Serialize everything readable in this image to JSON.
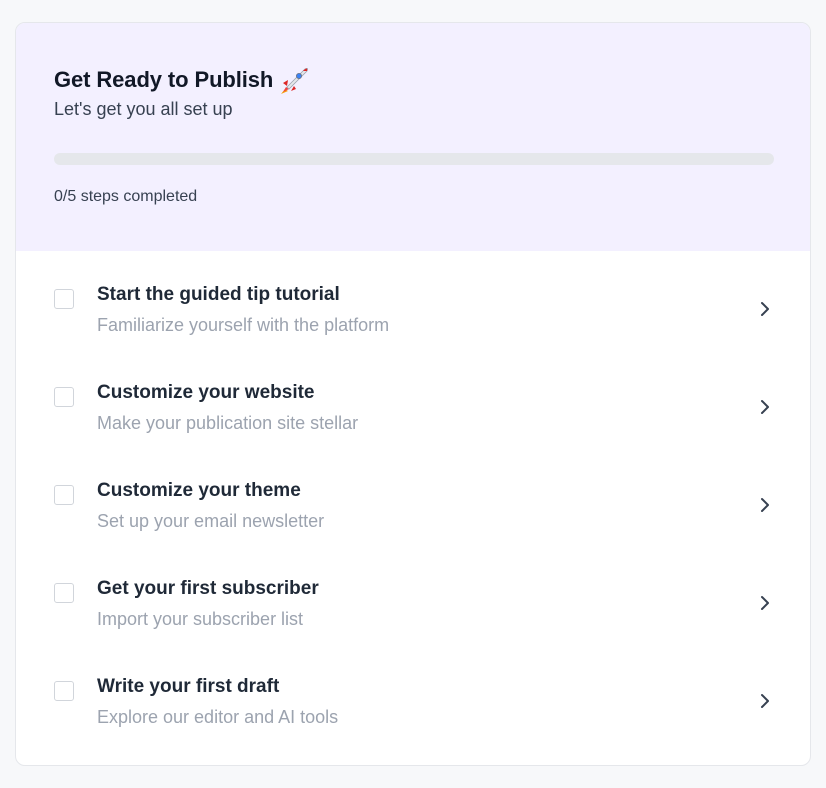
{
  "header": {
    "title": "Get Ready to Publish",
    "title_icon": "rocket-emoji",
    "subtitle": "Let's get you all set up",
    "progress": {
      "completed": 0,
      "total": 5,
      "fraction": 0,
      "label": "0/5 steps completed"
    }
  },
  "steps": [
    {
      "title": "Start the guided tip tutorial",
      "description": "Familiarize yourself with the platform",
      "checked": false
    },
    {
      "title": "Customize your website",
      "description": "Make your publication site stellar",
      "checked": false
    },
    {
      "title": "Customize your theme",
      "description": "Set up your email newsletter",
      "checked": false
    },
    {
      "title": "Get your first subscriber",
      "description": "Import your subscriber list",
      "checked": false
    },
    {
      "title": "Write your first draft",
      "description": "Explore our editor and AI tools",
      "checked": false
    }
  ],
  "colors": {
    "header_bg": "#f3f0ff",
    "accent": "#7c3aed",
    "track": "#e5e7eb"
  }
}
